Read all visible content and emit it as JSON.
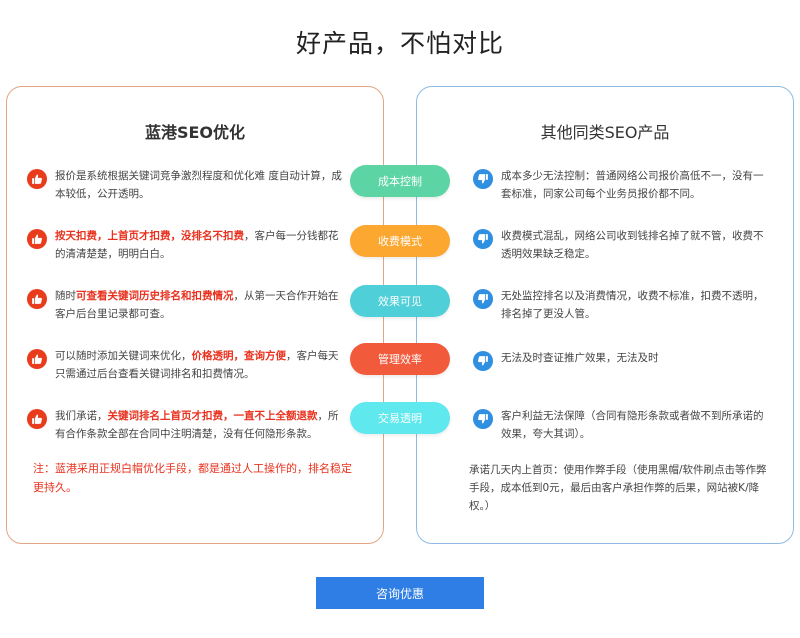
{
  "title": "好产品，不怕对比",
  "left": {
    "heading": "蓝港SEO优化",
    "rows": [
      {
        "parts": [
          {
            "t": "报价是系统根据关键词竞争激烈程度和优化难 度自动计算，成本较低，公开透明。",
            "h": false
          }
        ]
      },
      {
        "parts": [
          {
            "t": "按天扣费，上首页才扣费，没排名不扣费",
            "h": true
          },
          {
            "t": "，客户每一分钱都花的清清楚楚，明明白白。",
            "h": false
          }
        ]
      },
      {
        "parts": [
          {
            "t": "随时",
            "h": false
          },
          {
            "t": "可查看关键词历史排名和扣费情况",
            "h": true
          },
          {
            "t": "，从第一天合作开始在客户后台里记录都可查。",
            "h": false
          }
        ]
      },
      {
        "parts": [
          {
            "t": "可以随时添加关键词来优化，",
            "h": false
          },
          {
            "t": "价格透明，查询方便",
            "h": true
          },
          {
            "t": "，客户每天只需通过后台查看关键词排名和扣费情况。",
            "h": false
          }
        ]
      },
      {
        "parts": [
          {
            "t": "我们承诺，",
            "h": false
          },
          {
            "t": "关键词排名上首页才扣费，一直不上全额退款",
            "h": true
          },
          {
            "t": "，所有合作条款全部在合同中注明清楚，没有任何隐形条款。",
            "h": false
          }
        ]
      }
    ],
    "note": "注：蓝港采用正规白帽优化手段，都是通过人工操作的，排名稳定更持久。"
  },
  "right": {
    "heading": "其他同类SEO产品",
    "rows": [
      "成本多少无法控制：普通网络公司报价高低不一，没有一套标准，同家公司每个业务员报价都不同。",
      "收费模式混乱，网络公司收到钱排名掉了就不管，收费不透明效果缺乏稳定。",
      "无处监控排名以及消费情况，收费不标准，扣费不透明，排名掉了更没人管。",
      "无法及时查证推广效果，无法及时",
      "客户利益无法保障（合同有隐形条款或者做不到所承诺的效果，夸大其词）。"
    ],
    "extra": "承诺几天内上首页：使用作弊手段（使用黑帽/软件刷点击等作弊手段，成本低到0元，最后由客户承担作弊的后果，网站被K/降权。）"
  },
  "pills": [
    {
      "label": "成本控制",
      "color": "#5cd4a4"
    },
    {
      "label": "收费模式",
      "color": "#fba730"
    },
    {
      "label": "效果可见",
      "color": "#4fcfd8"
    },
    {
      "label": "管理效率",
      "color": "#f25a3c"
    },
    {
      "label": "交易透明",
      "color": "#5fe8ee"
    }
  ],
  "cta": {
    "label": "咨询优惠"
  },
  "icons": {
    "left": "thumbs-up-icon",
    "right": "thumbs-down-icon"
  }
}
